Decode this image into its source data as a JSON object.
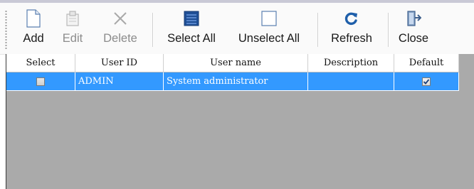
{
  "toolbar": {
    "buttons": [
      {
        "label": "Add",
        "icon": "new-document-icon",
        "enabled": true
      },
      {
        "label": "Edit",
        "icon": "edit-document-icon",
        "enabled": false
      },
      {
        "label": "Delete",
        "icon": "delete-x-icon",
        "enabled": false
      },
      {
        "label": "Select All",
        "icon": "select-all-icon",
        "enabled": true
      },
      {
        "label": "Unselect All",
        "icon": "unselect-all-icon",
        "enabled": true
      },
      {
        "label": "Refresh",
        "icon": "refresh-icon",
        "enabled": true
      },
      {
        "label": "Close",
        "icon": "exit-door-icon",
        "enabled": true
      }
    ]
  },
  "grid": {
    "columns": [
      "Select",
      "User ID",
      "User name",
      "Description",
      "Default"
    ],
    "rows": [
      {
        "select": false,
        "user_id": "ADMIN",
        "user_name": "System administrator",
        "description": "",
        "default": true
      }
    ],
    "selection_color": "#3399ff",
    "empty_area_color": "#aaaaaa"
  }
}
